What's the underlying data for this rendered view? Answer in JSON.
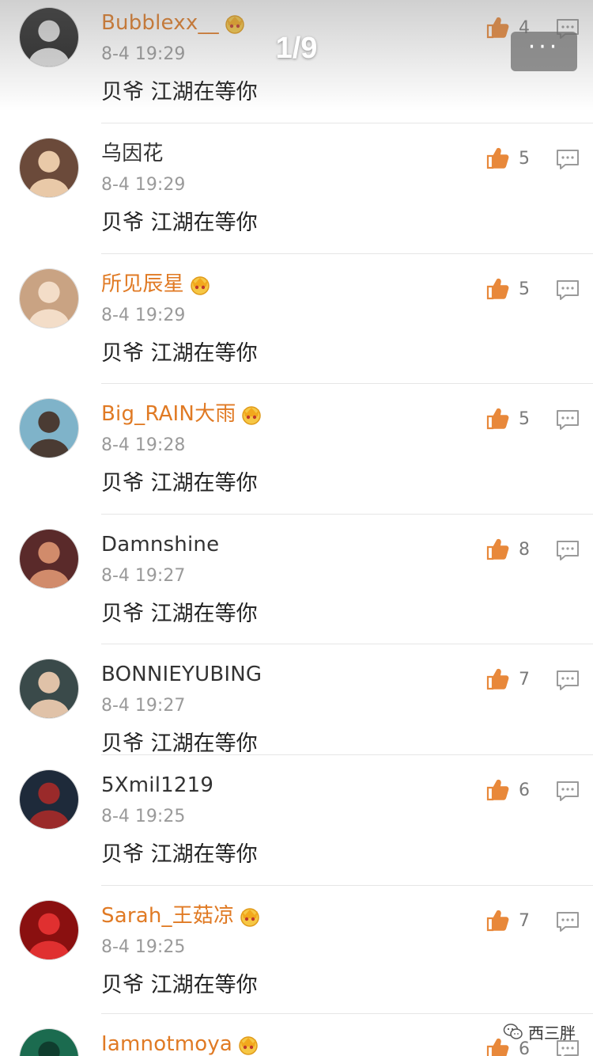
{
  "viewer": {
    "page_indicator": "1/9",
    "more_label": "···"
  },
  "colors": {
    "vip_name": "#e07a24",
    "normal_name": "#333333",
    "time": "#9a9a9a",
    "like_icon": "#e8883a"
  },
  "comments": [
    {
      "name": "Bubblexx__",
      "vip": true,
      "time": "8-4 19:29",
      "text": "贝爷  江湖在等你",
      "likes": "4"
    },
    {
      "name": "乌因花",
      "vip": false,
      "time": "8-4 19:29",
      "text": "贝爷 江湖在等你",
      "likes": "5"
    },
    {
      "name": "所见辰星",
      "vip": true,
      "time": "8-4 19:29",
      "text": "贝爷  江湖在等你",
      "likes": "5"
    },
    {
      "name": "Big_RAIN大雨",
      "vip": true,
      "time": "8-4 19:28",
      "text": "贝爷  江湖在等你",
      "likes": "5"
    },
    {
      "name": "Damnshine",
      "vip": false,
      "time": "8-4 19:27",
      "text": "贝爷 江湖在等你",
      "likes": "8"
    },
    {
      "name": "BONNIEYUBING",
      "vip": false,
      "time": "8-4 19:27",
      "text": "贝爷 江湖在等你",
      "likes": "7"
    },
    {
      "name": "5Xmil1219",
      "vip": false,
      "time": "8-4 19:25",
      "text": "贝爷 江湖在等你",
      "likes": "6"
    },
    {
      "name": "Sarah_王菇凉",
      "vip": true,
      "time": "8-4 19:25",
      "text": "贝爷  江湖在等你",
      "likes": "7"
    },
    {
      "name": "Iamnotmoya",
      "vip": true,
      "time": "",
      "text": "",
      "likes": "6"
    }
  ],
  "watermark": {
    "text": "西三胖"
  }
}
